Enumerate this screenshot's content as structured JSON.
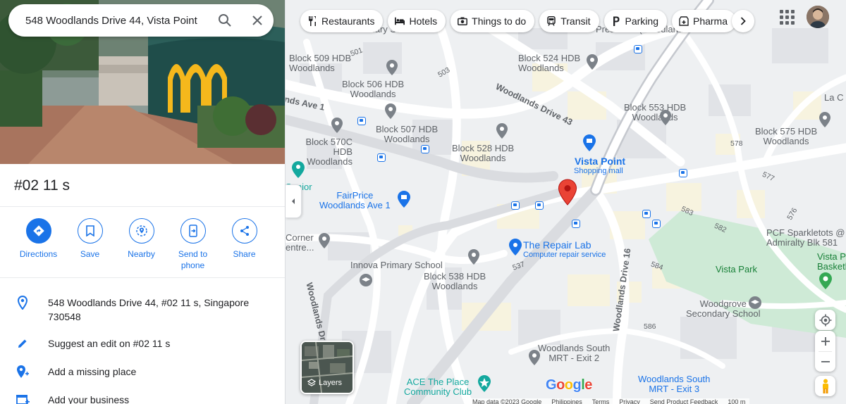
{
  "search": {
    "query": "548 Woodlands Drive 44, Vista Point"
  },
  "place": {
    "title": "#02 11 s",
    "actions": [
      {
        "label": "Directions",
        "icon": "directions-icon"
      },
      {
        "label": "Save",
        "icon": "bookmark-icon"
      },
      {
        "label": "Nearby",
        "icon": "nearby-icon"
      },
      {
        "label": "Send to\nphone",
        "icon": "send-to-phone-icon"
      },
      {
        "label": "Share",
        "icon": "share-icon"
      }
    ],
    "address": "548 Woodlands Drive 44, #02 11 s, Singapore 730548",
    "suggest_edit": "Suggest an edit on #02 11 s",
    "add_missing_place": "Add a missing place",
    "add_business": "Add your business"
  },
  "chips": [
    "Restaurants",
    "Hotels",
    "Things to do",
    "Transit",
    "Parking",
    "Pharma"
  ],
  "map": {
    "labels": {
      "block509": "Block 509 HDB\nWoodlands",
      "block524": "Block 524 HDB\nWoodlands",
      "block506": "Block 506 HDB\nWoodlands",
      "block553": "Block 553 HDB\nWoodlands",
      "block507": "Block 507 HDB\nWoodlands",
      "block570c": "Block 570C\nHDB Woodlands",
      "block528": "Block 528 HDB\nWoodlands",
      "block575": "Block 575 HDB\nWoodlands",
      "block538": "Block 538 HDB\nWoodlands",
      "vista_point": "Vista Point",
      "vista_point_sub": "Shopping mall",
      "fairprice": "FairPrice\nWoodlands Ave 1",
      "repair_lab": "The Repair Lab",
      "repair_lab_sub": "Computer repair service",
      "innova": "Innova Primary School",
      "corner": "Corner\nentre...",
      "senior": "Senior\nnds",
      "pcf": "PCF Sparkletots @\nAdmiralty Blk 581",
      "vista_park_label": "Vista Park",
      "vista_pa": "Vista Pa\nBasketba",
      "woodgrove": "Woodgrove\nSecondary School",
      "wsouth2": "Woodlands South\nMRT - Exit 2",
      "wsouth3": "Woodlands South\nMRT - Exit 3",
      "ace": "ACE The Place\nCommunity Club",
      "primary_school": "Primary School",
      "preschool": "Preschool (Woodlands...",
      "la_c": "La C",
      "woodlands_ave1": "nds Ave 1",
      "woodlands_dr43": "Woodlands Drive 43",
      "woodlands_dr16": "Woodlands Drive 16",
      "woodlands_dr": "Woodlands Dr",
      "n501": "501",
      "n503": "503",
      "n578": "578",
      "n577": "577",
      "n583": "583",
      "n582": "582",
      "n576": "576",
      "n584": "584",
      "n537": "537",
      "n586": "586"
    },
    "layers_label": "Layers",
    "google_logo": "Google",
    "footer": [
      "Map data ©2023 Google",
      "Philippines",
      "Terms",
      "Privacy",
      "Send Product Feedback",
      "100 m"
    ]
  },
  "colors": {
    "accent": "#1a73e8",
    "pin": "#ea4335",
    "park": "#c8e6c9"
  }
}
